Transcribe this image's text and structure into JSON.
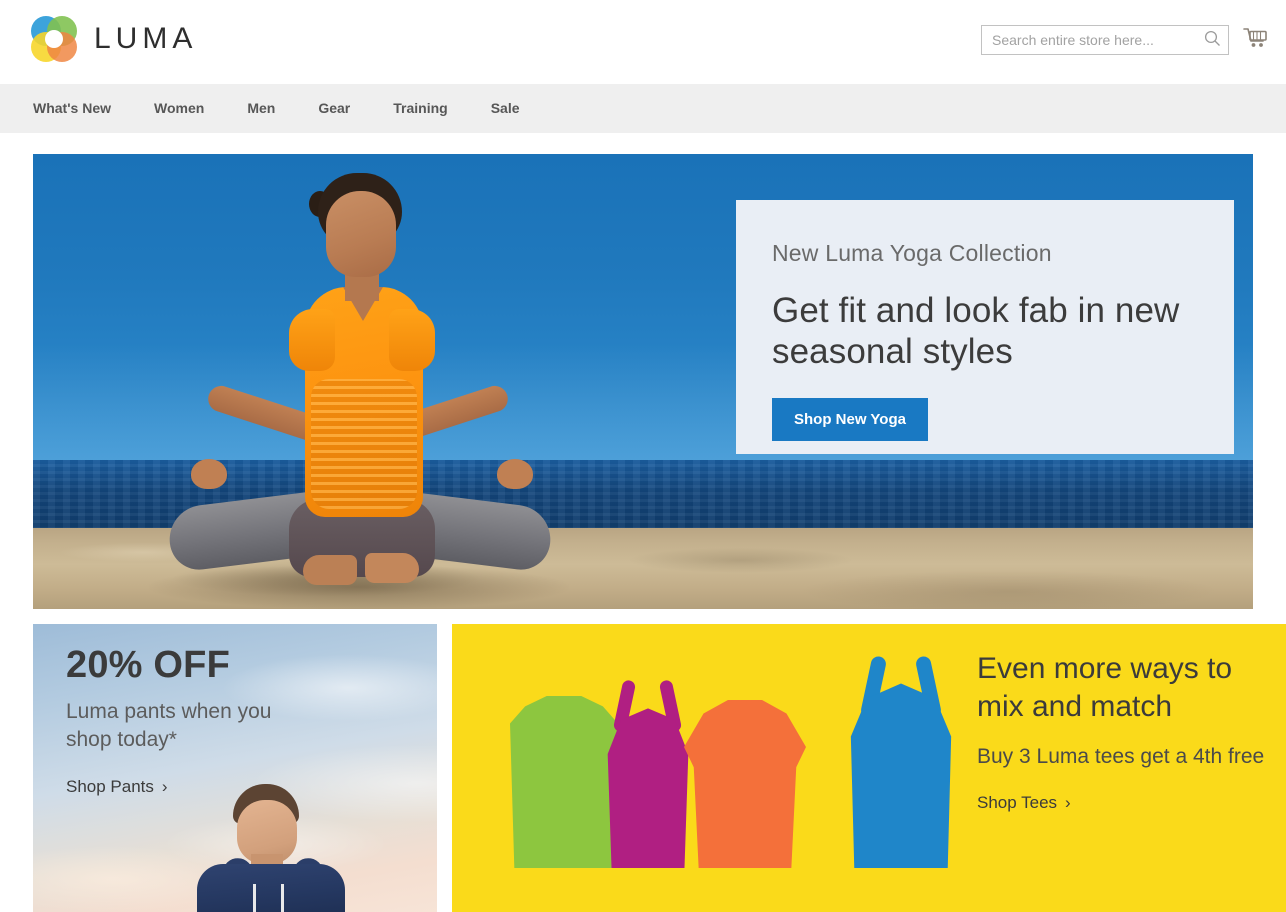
{
  "header": {
    "logo_text": "LUMA",
    "logo_icon": "luma-flower-logo",
    "search": {
      "placeholder": "Search entire store here...",
      "value": "",
      "icon": "search-icon"
    },
    "cart_icon": "shopping-cart-icon"
  },
  "nav": {
    "items": [
      {
        "label": "What's New"
      },
      {
        "label": "Women"
      },
      {
        "label": "Men"
      },
      {
        "label": "Gear"
      },
      {
        "label": "Training"
      },
      {
        "label": "Sale"
      }
    ]
  },
  "hero": {
    "image_alt": "woman meditating in lotus pose on a beach",
    "eyebrow": "New Luma Yoga Collection",
    "title": "Get fit and look fab in new seasonal styles",
    "button_label": "Shop New Yoga",
    "panel_bg": "#e9eef5",
    "button_bg": "#1979c3"
  },
  "promos": [
    {
      "name": "pants-promo",
      "headline": "20% OFF",
      "subhead": "Luma pants when you shop today*",
      "link_label": "Shop Pants",
      "link_chevron": "›",
      "image_alt": "man in navy hoodie against a sunset sky"
    },
    {
      "name": "tees-promo",
      "headline": "Even more ways to mix and match",
      "subhead": "Buy 3 Luma tees get a 4th free",
      "link_label": "Shop Tees",
      "link_chevron": "›",
      "bg": "#fada1a",
      "image_alt": "four colored shirt silhouettes",
      "shirt_colors": [
        "#8dc63f",
        "#b01f82",
        "#f4703a",
        "#1f86c9"
      ]
    }
  ]
}
